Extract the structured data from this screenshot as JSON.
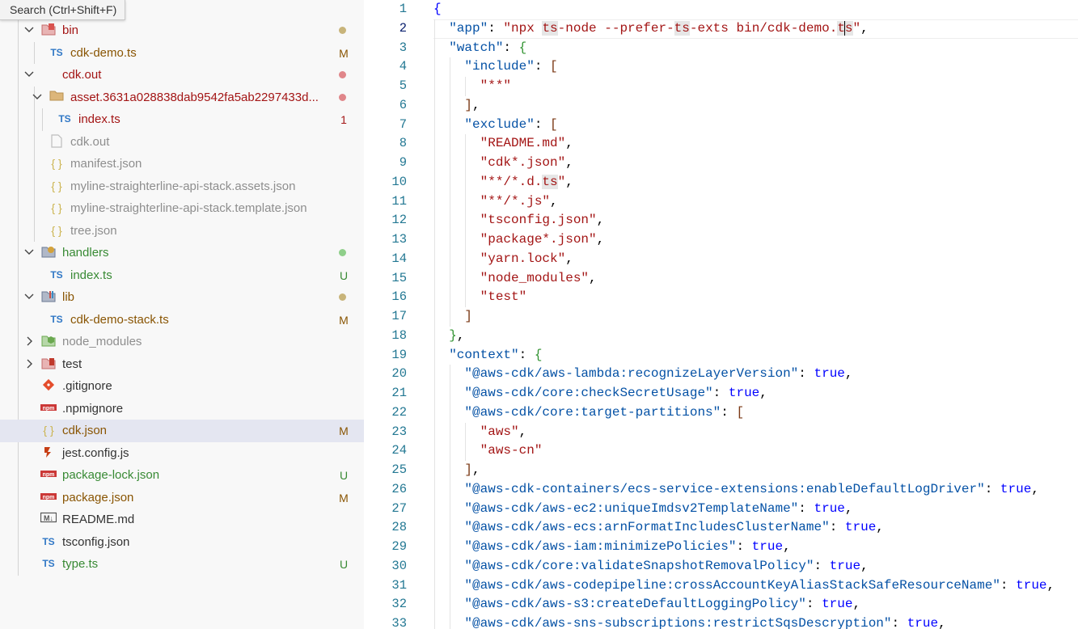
{
  "search_tooltip": "Search (Ctrl+Shift+F)",
  "explorer": {
    "items": [
      {
        "depth": 1,
        "chevron": "down",
        "icon": "bin-folder-icon",
        "name": "bin",
        "color": "#a31515",
        "badge": "",
        "dot": "#c8b47a"
      },
      {
        "depth": 2,
        "chevron": "",
        "icon": "typescript-icon",
        "name": "cdk-demo.ts",
        "color": "#895503",
        "badge": "M",
        "dot": ""
      },
      {
        "depth": 1,
        "chevron": "down",
        "icon": "",
        "name": "cdk.out",
        "color": "#a31515",
        "badge": "",
        "dot": "#e0868a"
      },
      {
        "depth": 2,
        "chevron": "down",
        "icon": "folder-icon",
        "name": "asset.3631a028838dab9542fa5ab2297433d...",
        "color": "#a31515",
        "badge": "",
        "dot": "#e0868a"
      },
      {
        "depth": 3,
        "chevron": "",
        "icon": "typescript-icon",
        "name": "index.ts",
        "color": "#a31515",
        "badge": "1",
        "dot": ""
      },
      {
        "depth": 2,
        "chevron": "",
        "icon": "file-icon",
        "name": "cdk.out",
        "color": "#8e8e8e",
        "badge": "",
        "dot": ""
      },
      {
        "depth": 2,
        "chevron": "",
        "icon": "json-icon",
        "name": "manifest.json",
        "color": "#8e8e8e",
        "badge": "",
        "dot": ""
      },
      {
        "depth": 2,
        "chevron": "",
        "icon": "json-icon",
        "name": "myline-straighterline-api-stack.assets.json",
        "color": "#8e8e8e",
        "badge": "",
        "dot": ""
      },
      {
        "depth": 2,
        "chevron": "",
        "icon": "json-icon",
        "name": "myline-straighterline-api-stack.template.json",
        "color": "#8e8e8e",
        "badge": "",
        "dot": ""
      },
      {
        "depth": 2,
        "chevron": "",
        "icon": "json-icon",
        "name": "tree.json",
        "color": "#8e8e8e",
        "badge": "",
        "dot": ""
      },
      {
        "depth": 1,
        "chevron": "down",
        "icon": "handlers-folder-icon",
        "name": "handlers",
        "color": "#388a34",
        "badge": "",
        "dot": "#8fcf8a"
      },
      {
        "depth": 2,
        "chevron": "",
        "icon": "typescript-icon",
        "name": "index.ts",
        "color": "#388a34",
        "badge": "U",
        "dot": ""
      },
      {
        "depth": 1,
        "chevron": "down",
        "icon": "lib-folder-icon",
        "name": "lib",
        "color": "#895503",
        "badge": "",
        "dot": "#c8b47a"
      },
      {
        "depth": 2,
        "chevron": "",
        "icon": "typescript-icon",
        "name": "cdk-demo-stack.ts",
        "color": "#895503",
        "badge": "M",
        "dot": ""
      },
      {
        "depth": 1,
        "chevron": "right",
        "icon": "node-folder-icon",
        "name": "node_modules",
        "color": "#8e8e8e",
        "badge": "",
        "dot": ""
      },
      {
        "depth": 1,
        "chevron": "right",
        "icon": "test-folder-icon",
        "name": "test",
        "color": "#333333",
        "badge": "",
        "dot": ""
      },
      {
        "depth": 1,
        "chevron": "",
        "icon": "git-icon",
        "name": ".gitignore",
        "color": "#333333",
        "badge": "",
        "dot": ""
      },
      {
        "depth": 1,
        "chevron": "",
        "icon": "npm-icon",
        "name": ".npmignore",
        "color": "#333333",
        "badge": "",
        "dot": ""
      },
      {
        "depth": 1,
        "chevron": "",
        "icon": "json-icon",
        "name": "cdk.json",
        "color": "#895503",
        "badge": "M",
        "dot": "",
        "selected": true
      },
      {
        "depth": 1,
        "chevron": "",
        "icon": "jest-icon",
        "name": "jest.config.js",
        "color": "#333333",
        "badge": "",
        "dot": ""
      },
      {
        "depth": 1,
        "chevron": "",
        "icon": "npm-icon",
        "name": "package-lock.json",
        "color": "#388a34",
        "badge": "U",
        "dot": ""
      },
      {
        "depth": 1,
        "chevron": "",
        "icon": "npm-icon",
        "name": "package.json",
        "color": "#895503",
        "badge": "M",
        "dot": ""
      },
      {
        "depth": 1,
        "chevron": "",
        "icon": "markdown-icon",
        "name": "README.md",
        "color": "#333333",
        "badge": "",
        "dot": ""
      },
      {
        "depth": 1,
        "chevron": "",
        "icon": "tsconfig-icon",
        "name": "tsconfig.json",
        "color": "#333333",
        "badge": "",
        "dot": ""
      },
      {
        "depth": 1,
        "chevron": "",
        "icon": "typescript-icon",
        "name": "type.ts",
        "color": "#388a34",
        "badge": "U",
        "dot": ""
      }
    ]
  },
  "editor": {
    "active_line": 2,
    "lines": [
      [
        [
          "b",
          "{"
        ]
      ],
      [
        [
          "t",
          "  "
        ],
        [
          "k",
          "\"app\""
        ],
        [
          "t",
          ": "
        ],
        [
          "s",
          "\"npx "
        ],
        [
          "sh",
          "ts"
        ],
        [
          "s",
          "-node --prefer-"
        ],
        [
          "sh",
          "ts"
        ],
        [
          "s",
          "-exts bin/cdk-demo."
        ],
        [
          "sh",
          "t"
        ],
        [
          "cur",
          ""
        ],
        [
          "sh",
          "s"
        ],
        [
          "s",
          "\""
        ],
        [
          "t",
          ","
        ]
      ],
      [
        [
          "t",
          "  "
        ],
        [
          "k",
          "\"watch\""
        ],
        [
          "t",
          ": "
        ],
        [
          "y",
          "{"
        ]
      ],
      [
        [
          "t",
          "    "
        ],
        [
          "k",
          "\"include\""
        ],
        [
          "t",
          ": "
        ],
        [
          "p",
          "["
        ]
      ],
      [
        [
          "t",
          "      "
        ],
        [
          "s",
          "\"**\""
        ]
      ],
      [
        [
          "t",
          "    "
        ],
        [
          "p",
          "]"
        ],
        [
          "t",
          ","
        ]
      ],
      [
        [
          "t",
          "    "
        ],
        [
          "k",
          "\"exclude\""
        ],
        [
          "t",
          ": "
        ],
        [
          "p",
          "["
        ]
      ],
      [
        [
          "t",
          "      "
        ],
        [
          "s",
          "\"README.md\""
        ],
        [
          "t",
          ","
        ]
      ],
      [
        [
          "t",
          "      "
        ],
        [
          "s",
          "\"cdk*.json\""
        ],
        [
          "t",
          ","
        ]
      ],
      [
        [
          "t",
          "      "
        ],
        [
          "s",
          "\"**/*.d."
        ],
        [
          "sh",
          "ts"
        ],
        [
          "s",
          "\""
        ],
        [
          "t",
          ","
        ]
      ],
      [
        [
          "t",
          "      "
        ],
        [
          "s",
          "\"**/*.js\""
        ],
        [
          "t",
          ","
        ]
      ],
      [
        [
          "t",
          "      "
        ],
        [
          "s",
          "\"tsconfig.json\""
        ],
        [
          "t",
          ","
        ]
      ],
      [
        [
          "t",
          "      "
        ],
        [
          "s",
          "\"package*.json\""
        ],
        [
          "t",
          ","
        ]
      ],
      [
        [
          "t",
          "      "
        ],
        [
          "s",
          "\"yarn.lock\""
        ],
        [
          "t",
          ","
        ]
      ],
      [
        [
          "t",
          "      "
        ],
        [
          "s",
          "\"node_modules\""
        ],
        [
          "t",
          ","
        ]
      ],
      [
        [
          "t",
          "      "
        ],
        [
          "s",
          "\"test\""
        ]
      ],
      [
        [
          "t",
          "    "
        ],
        [
          "p",
          "]"
        ]
      ],
      [
        [
          "t",
          "  "
        ],
        [
          "y",
          "}"
        ],
        [
          "t",
          ","
        ]
      ],
      [
        [
          "t",
          "  "
        ],
        [
          "k",
          "\"context\""
        ],
        [
          "t",
          ": "
        ],
        [
          "y",
          "{"
        ]
      ],
      [
        [
          "t",
          "    "
        ],
        [
          "k",
          "\"@aws-cdk/aws-lambda:recognizeLayerVersion\""
        ],
        [
          "t",
          ": "
        ],
        [
          "b",
          "true"
        ],
        [
          "t",
          ","
        ]
      ],
      [
        [
          "t",
          "    "
        ],
        [
          "k",
          "\"@aws-cdk/core:checkSecretUsage\""
        ],
        [
          "t",
          ": "
        ],
        [
          "b",
          "true"
        ],
        [
          "t",
          ","
        ]
      ],
      [
        [
          "t",
          "    "
        ],
        [
          "k",
          "\"@aws-cdk/core:target-partitions\""
        ],
        [
          "t",
          ": "
        ],
        [
          "p",
          "["
        ]
      ],
      [
        [
          "t",
          "      "
        ],
        [
          "s",
          "\"aws\""
        ],
        [
          "t",
          ","
        ]
      ],
      [
        [
          "t",
          "      "
        ],
        [
          "s",
          "\"aws-cn\""
        ]
      ],
      [
        [
          "t",
          "    "
        ],
        [
          "p",
          "]"
        ],
        [
          "t",
          ","
        ]
      ],
      [
        [
          "t",
          "    "
        ],
        [
          "k",
          "\"@aws-cdk-containers/ecs-service-extensions:enableDefaultLogDriver\""
        ],
        [
          "t",
          ": "
        ],
        [
          "b",
          "true"
        ],
        [
          "t",
          ","
        ]
      ],
      [
        [
          "t",
          "    "
        ],
        [
          "k",
          "\"@aws-cdk/aws-ec2:uniqueImdsv2TemplateName\""
        ],
        [
          "t",
          ": "
        ],
        [
          "b",
          "true"
        ],
        [
          "t",
          ","
        ]
      ],
      [
        [
          "t",
          "    "
        ],
        [
          "k",
          "\"@aws-cdk/aws-ecs:arnFormatIncludesClusterName\""
        ],
        [
          "t",
          ": "
        ],
        [
          "b",
          "true"
        ],
        [
          "t",
          ","
        ]
      ],
      [
        [
          "t",
          "    "
        ],
        [
          "k",
          "\"@aws-cdk/aws-iam:minimizePolicies\""
        ],
        [
          "t",
          ": "
        ],
        [
          "b",
          "true"
        ],
        [
          "t",
          ","
        ]
      ],
      [
        [
          "t",
          "    "
        ],
        [
          "k",
          "\"@aws-cdk/core:validateSnapshotRemovalPolicy\""
        ],
        [
          "t",
          ": "
        ],
        [
          "b",
          "true"
        ],
        [
          "t",
          ","
        ]
      ],
      [
        [
          "t",
          "    "
        ],
        [
          "k",
          "\"@aws-cdk/aws-codepipeline:crossAccountKeyAliasStackSafeResourceName\""
        ],
        [
          "t",
          ": "
        ],
        [
          "b",
          "true"
        ],
        [
          "t",
          ","
        ]
      ],
      [
        [
          "t",
          "    "
        ],
        [
          "k",
          "\"@aws-cdk/aws-s3:createDefaultLoggingPolicy\""
        ],
        [
          "t",
          ": "
        ],
        [
          "b",
          "true"
        ],
        [
          "t",
          ","
        ]
      ],
      [
        [
          "t",
          "    "
        ],
        [
          "k",
          "\"@aws-cdk/aws-sns-subscriptions:restrictSqsDescryption\""
        ],
        [
          "t",
          ": "
        ],
        [
          "b",
          "true"
        ],
        [
          "t",
          ","
        ]
      ]
    ]
  }
}
